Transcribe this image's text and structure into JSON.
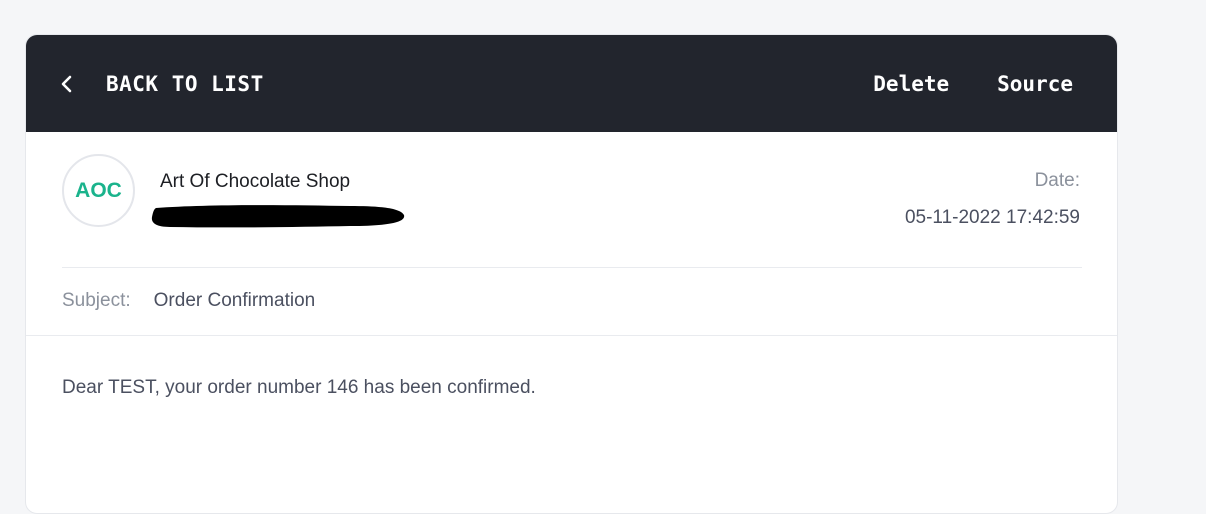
{
  "topbar": {
    "back_label": "BACK TO LIST",
    "back_icon": "chevron-left-icon",
    "delete_label": "Delete",
    "source_label": "Source"
  },
  "message": {
    "avatar_initials": "AOC",
    "sender_name": "Art Of Chocolate Shop",
    "date_label": "Date:",
    "date_value": "05-11-2022 17:42:59",
    "subject_label": "Subject:",
    "subject_value": "Order Confirmation",
    "body": "Dear TEST, your order number 146 has been confirmed."
  },
  "colors": {
    "page_background": "#f5f6f8",
    "topbar_background": "#22252d",
    "avatar_text": "#1ab38c",
    "muted_text": "#8b919c",
    "body_text": "#4b5060"
  }
}
